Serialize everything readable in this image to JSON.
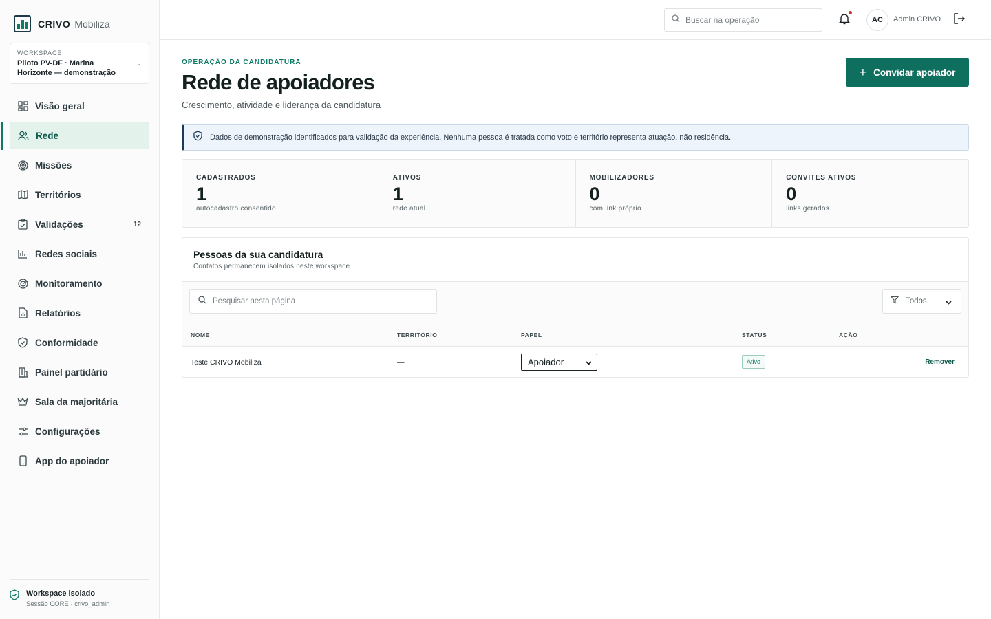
{
  "app": {
    "brand": "CRIVO",
    "product": "Mobiliza"
  },
  "workspace": {
    "label": "WORKSPACE",
    "name": "Piloto PV-DF · Marina Horizonte — demonstração"
  },
  "sidebar": {
    "items": [
      {
        "label": "Visão geral",
        "icon": "grid-icon"
      },
      {
        "label": "Rede",
        "icon": "users-icon",
        "active": true
      },
      {
        "label": "Missões",
        "icon": "target-icon"
      },
      {
        "label": "Territórios",
        "icon": "map-icon"
      },
      {
        "label": "Validações",
        "icon": "clipboard-check-icon",
        "badge": "12"
      },
      {
        "label": "Redes sociais",
        "icon": "bar-chart-icon"
      },
      {
        "label": "Monitoramento",
        "icon": "radar-icon"
      },
      {
        "label": "Relatórios",
        "icon": "report-icon"
      },
      {
        "label": "Conformidade",
        "icon": "shield-check-icon"
      },
      {
        "label": "Painel partidário",
        "icon": "building-icon"
      },
      {
        "label": "Sala da majoritária",
        "icon": "crown-icon"
      },
      {
        "label": "Configurações",
        "icon": "sliders-icon"
      },
      {
        "label": "App do apoiador",
        "icon": "phone-icon"
      }
    ],
    "footer": {
      "title": "Workspace isolado",
      "subtitle": "Sessão CORE · crivo_admin"
    }
  },
  "topbar": {
    "search_placeholder": "Buscar na operação",
    "avatar_initials": "AC",
    "user_name": "Admin CRIVO"
  },
  "header": {
    "eyebrow": "OPERAÇÃO DA CANDIDATURA",
    "title": "Rede de apoiadores",
    "subtitle": "Crescimento, atividade e liderança da candidatura",
    "invite_button": "Convidar apoiador"
  },
  "notice": "Dados de demonstração identificados para validação da experiência. Nenhuma pessoa é tratada como voto e território representa atuação, não residência.",
  "stats": [
    {
      "label": "CADASTRADOS",
      "value": "1",
      "caption": "autocadastro consentido"
    },
    {
      "label": "ATIVOS",
      "value": "1",
      "caption": "rede atual"
    },
    {
      "label": "MOBILIZADORES",
      "value": "0",
      "caption": "com link próprio"
    },
    {
      "label": "CONVITES ATIVOS",
      "value": "0",
      "caption": "links gerados"
    }
  ],
  "people": {
    "title": "Pessoas da sua candidatura",
    "subtitle": "Contatos permanecem isolados neste workspace",
    "search_placeholder": "Pesquisar nesta página",
    "filter_value": "Todos",
    "columns": [
      "NOME",
      "TERRITÓRIO",
      "PAPEL",
      "STATUS",
      "AÇÃO"
    ],
    "rows": [
      {
        "name": "Teste CRIVO Mobiliza",
        "territory": "—",
        "role": "Apoiador",
        "status": "Ativo",
        "action": "Remover"
      }
    ]
  },
  "colors": {
    "accent": "#0f7a66",
    "button": "#0f6f5f",
    "notice_bg": "#eef4fb",
    "alert_dot": "#d2322b"
  }
}
